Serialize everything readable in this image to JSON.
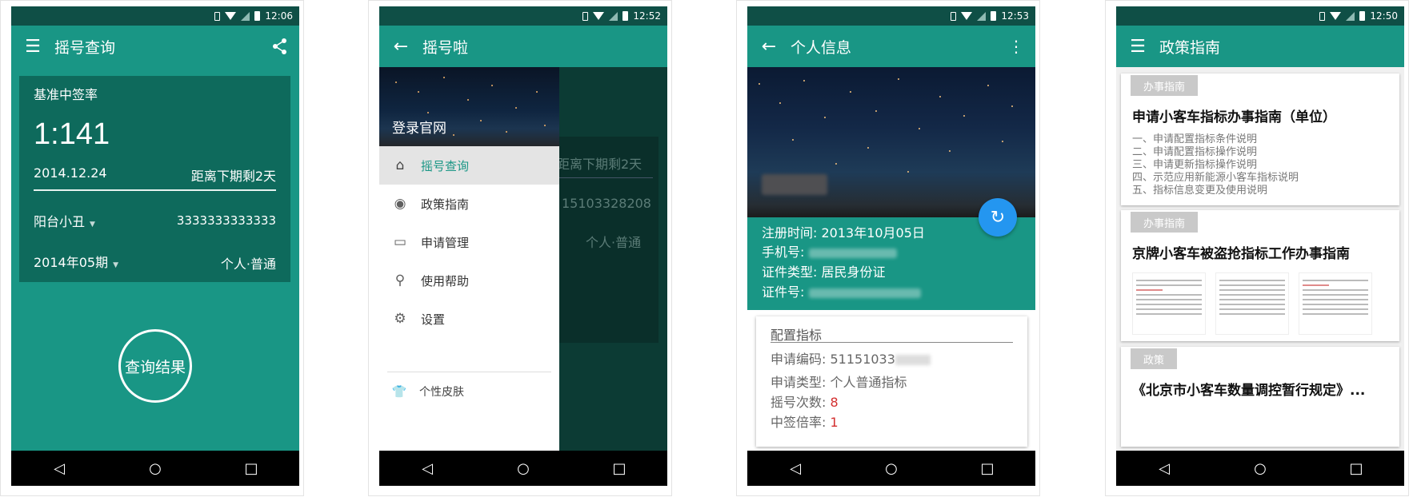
{
  "status": {
    "screen1_time": "12:06",
    "screen2_time": "12:52",
    "screen3_time": "12:53",
    "screen4_time": "12:50"
  },
  "screen1": {
    "title": "摇号查询",
    "rate_label": "基准中签率",
    "rate_value": "1:141",
    "date": "2014.12.24",
    "next_period": "距离下期剩2天",
    "user_name": "阳台小丑",
    "user_code": "3333333333333",
    "period": "2014年05期",
    "user_type": "个人·普通",
    "query_button": "查询结果"
  },
  "screen2": {
    "title": "摇号啦",
    "drawer_header": "登录官网",
    "menu": [
      {
        "label": "摇号查询",
        "icon": "home-icon"
      },
      {
        "label": "政策指南",
        "icon": "compass-icon"
      },
      {
        "label": "申请管理",
        "icon": "card-icon"
      },
      {
        "label": "使用帮助",
        "icon": "wrench-icon"
      },
      {
        "label": "设置",
        "icon": "gear-icon"
      }
    ],
    "skin_label": "个性皮肤",
    "bg_next_period": "距离下期剩2天",
    "bg_code": "15103328208",
    "bg_type": "个人·普通"
  },
  "screen3": {
    "title": "个人信息",
    "register_time": "注册时间: 2013年10月05日",
    "phone_label": "手机号:",
    "id_type": "证件类型: 居民身份证",
    "id_label": "证件号:",
    "card_title": "配置指标",
    "apply_code": "申请编码: 51151033",
    "apply_type": "申请类型: 个人普通指标",
    "draw_count_label": "摇号次数:",
    "draw_count_value": "8",
    "win_rate_label": "中签倍率:",
    "win_rate_value": "1"
  },
  "screen4": {
    "title": "政策指南",
    "cards": [
      {
        "tag": "办事指南",
        "title": "申请小客车指标办事指南（单位）",
        "items": [
          "一、申请配置指标条件说明",
          "二、申请配置指标操作说明",
          "三、申请更新指标操作说明",
          "四、示范应用新能源小客车指标说明",
          "五、指标信息变更及使用说明"
        ]
      },
      {
        "tag": "办事指南",
        "title": "京牌小客车被盗抢指标工作办事指南"
      },
      {
        "tag": "政策",
        "title": "《北京市小客车数量调控暂行规定》..."
      }
    ]
  },
  "colors": {
    "primary": "#199685",
    "status_bar": "#0f4f46",
    "card_dark": "#0e6a5c",
    "fab_blue": "#2496f0",
    "red_value": "#d32f2f"
  }
}
